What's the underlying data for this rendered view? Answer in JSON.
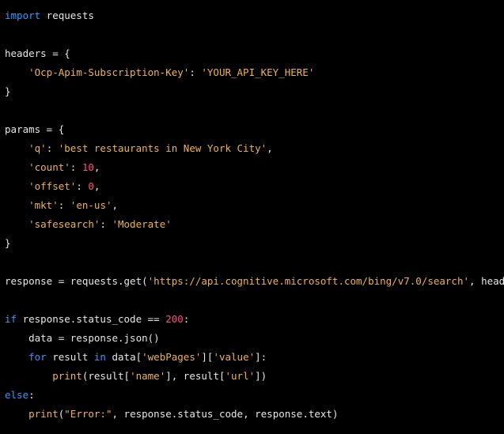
{
  "editor": {
    "lines": [
      [
        {
          "t": "import",
          "c": "keyword"
        },
        {
          "t": " requests",
          "c": "plain"
        }
      ],
      [],
      [
        {
          "t": "headers = {",
          "c": "plain"
        }
      ],
      [
        {
          "t": "    ",
          "c": "plain"
        },
        {
          "t": "'Ocp-Apim-Subscription-Key'",
          "c": "string"
        },
        {
          "t": ": ",
          "c": "plain"
        },
        {
          "t": "'YOUR_API_KEY_HERE'",
          "c": "string"
        }
      ],
      [
        {
          "t": "}",
          "c": "plain"
        }
      ],
      [],
      [
        {
          "t": "params = {",
          "c": "plain"
        }
      ],
      [
        {
          "t": "    ",
          "c": "plain"
        },
        {
          "t": "'q'",
          "c": "string"
        },
        {
          "t": ": ",
          "c": "plain"
        },
        {
          "t": "'best restaurants in New York City'",
          "c": "string"
        },
        {
          "t": ",",
          "c": "plain"
        }
      ],
      [
        {
          "t": "    ",
          "c": "plain"
        },
        {
          "t": "'count'",
          "c": "string"
        },
        {
          "t": ": ",
          "c": "plain"
        },
        {
          "t": "10",
          "c": "number"
        },
        {
          "t": ",",
          "c": "plain"
        }
      ],
      [
        {
          "t": "    ",
          "c": "plain"
        },
        {
          "t": "'offset'",
          "c": "string"
        },
        {
          "t": ": ",
          "c": "plain"
        },
        {
          "t": "0",
          "c": "number"
        },
        {
          "t": ",",
          "c": "plain"
        }
      ],
      [
        {
          "t": "    ",
          "c": "plain"
        },
        {
          "t": "'mkt'",
          "c": "string"
        },
        {
          "t": ": ",
          "c": "plain"
        },
        {
          "t": "'en-us'",
          "c": "string"
        },
        {
          "t": ",",
          "c": "plain"
        }
      ],
      [
        {
          "t": "    ",
          "c": "plain"
        },
        {
          "t": "'safesearch'",
          "c": "string"
        },
        {
          "t": ": ",
          "c": "plain"
        },
        {
          "t": "'Moderate'",
          "c": "string"
        }
      ],
      [
        {
          "t": "}",
          "c": "plain"
        }
      ],
      [],
      [
        {
          "t": "response = requests.get(",
          "c": "plain"
        },
        {
          "t": "'https://api.cognitive.microsoft.com/bing/v7.0/search'",
          "c": "string"
        },
        {
          "t": ", headers=hea",
          "c": "plain"
        }
      ],
      [],
      [
        {
          "t": "if",
          "c": "keyword"
        },
        {
          "t": " response.status_code == ",
          "c": "plain"
        },
        {
          "t": "200",
          "c": "number"
        },
        {
          "t": ":",
          "c": "plain"
        }
      ],
      [
        {
          "t": "    data = response.json()",
          "c": "plain"
        }
      ],
      [
        {
          "t": "    ",
          "c": "plain"
        },
        {
          "t": "for",
          "c": "keyword"
        },
        {
          "t": " result ",
          "c": "plain"
        },
        {
          "t": "in",
          "c": "keyword"
        },
        {
          "t": " data[",
          "c": "plain"
        },
        {
          "t": "'webPages'",
          "c": "string"
        },
        {
          "t": "][",
          "c": "plain"
        },
        {
          "t": "'value'",
          "c": "string"
        },
        {
          "t": "]:",
          "c": "plain"
        }
      ],
      [
        {
          "t": "        ",
          "c": "plain"
        },
        {
          "t": "print",
          "c": "builtin"
        },
        {
          "t": "(result[",
          "c": "plain"
        },
        {
          "t": "'name'",
          "c": "string"
        },
        {
          "t": "], result[",
          "c": "plain"
        },
        {
          "t": "'url'",
          "c": "string"
        },
        {
          "t": "])",
          "c": "plain"
        }
      ],
      [
        {
          "t": "else",
          "c": "keyword"
        },
        {
          "t": ":",
          "c": "plain"
        }
      ],
      [
        {
          "t": "    ",
          "c": "plain"
        },
        {
          "t": "print",
          "c": "builtin"
        },
        {
          "t": "(",
          "c": "plain"
        },
        {
          "t": "\"Error:\"",
          "c": "string"
        },
        {
          "t": ", response.status_code, response.text)",
          "c": "plain"
        }
      ]
    ]
  }
}
